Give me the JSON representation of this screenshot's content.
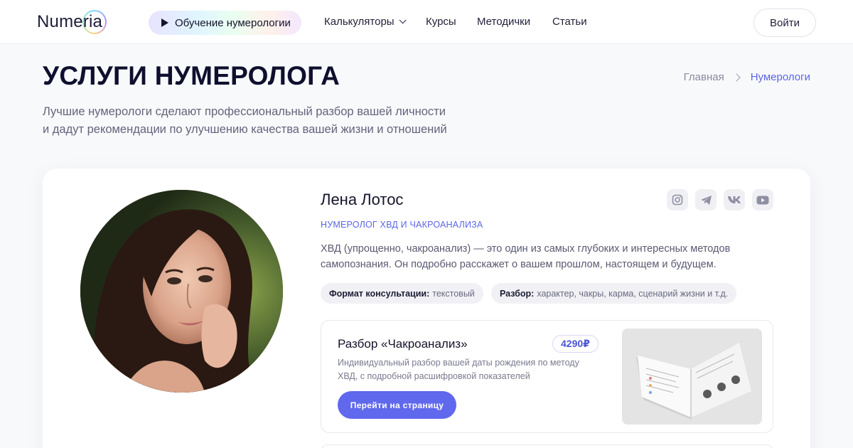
{
  "header": {
    "logo": "Numeria",
    "learn_button": "Обучение нумерологии",
    "nav": {
      "calculators": "Калькуляторы",
      "courses": "Курсы",
      "manuals": "Методички",
      "articles": "Статьи"
    },
    "login": "Войти"
  },
  "page": {
    "title": "УСЛУГИ НУМЕРОЛОГА",
    "intro_line1": "Лучшие нумерологи сделают профессиональный разбор вашей личности",
    "intro_line2": "и дадут рекомендации по улучшению качества вашей жизни и отношений"
  },
  "breadcrumb": {
    "home": "Главная",
    "current": "Нумерологи"
  },
  "specialist": {
    "name": "Лена Лотос",
    "role": "НУМЕРОЛОГ ХВД И ЧАКРОАНАЛИЗА",
    "desc_line1": "ХВД (упрощенно, чакроанализ) — это один из самых глубоких и интересных методов",
    "desc_line2": "самопознания. Он подробно расскажет о вашем прошлом, настоящем и будущем.",
    "socials": [
      "instagram-icon",
      "telegram-icon",
      "vk-icon",
      "youtube-icon"
    ],
    "format_label": "Формат консультации:",
    "format_value": "текстовый",
    "analysis_label": "Разбор:",
    "analysis_value": "характер, чакры, карма, сценарий жизни и т.д."
  },
  "service": {
    "title": "Разбор «Чакроанализ»",
    "price": "4290₽",
    "desc_line1": "Индивидуальный разбор вашей даты рождения по методу",
    "desc_line2": "ХВД, с подробной расшифровкой показателей",
    "button": "Перейти на страницу"
  },
  "colors": {
    "accent": "#5b66e6",
    "button": "#6068ee",
    "title": "#0f0f2e"
  }
}
